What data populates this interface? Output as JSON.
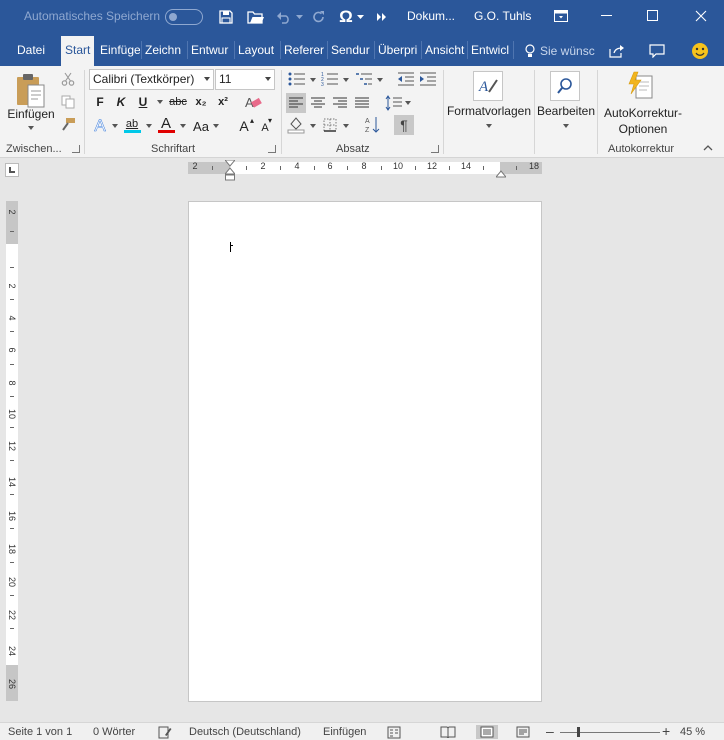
{
  "titlebar": {
    "autosave_label": "Automatisches Speichern",
    "doc_title": "Dokum...",
    "user_name": "G.O. Tuhls"
  },
  "tabs": {
    "items": [
      "Datei",
      "Start",
      "Einfüge",
      "Zeichn",
      "Entwur",
      "Layout",
      "Referer",
      "Sendur",
      "Überpri",
      "Ansicht",
      "Entwicl"
    ],
    "active": "Start",
    "tell_me": "Sie wünsc"
  },
  "ribbon": {
    "clipboard": {
      "paste_label": "Einfügen",
      "group_label": "Zwischen..."
    },
    "font": {
      "font_name": "Calibri (Textkörper)",
      "font_size": "11",
      "bold": "F",
      "italic": "K",
      "underline": "U",
      "strike": "abc",
      "subscript": "x₂",
      "superscript": "x²",
      "text_effects": "A",
      "highlight": "ab",
      "font_color": "A",
      "change_case": "Aa",
      "grow": "A",
      "shrink": "A",
      "group_label": "Schriftart"
    },
    "paragraph": {
      "show_marks": "¶",
      "group_label": "Absatz"
    },
    "styles": {
      "label": "Formatvorlagen"
    },
    "editing": {
      "label": "Bearbeiten"
    },
    "autocorrect": {
      "label_line1": "AutoKorrektur-",
      "label_line2": "Optionen",
      "group_label": "Autokorrektur"
    }
  },
  "ruler": {
    "h_labels": [
      "2",
      "2",
      "4",
      "6",
      "8",
      "10",
      "12",
      "14",
      "18"
    ],
    "v_labels": [
      "2",
      "2",
      "4",
      "6",
      "8",
      "10",
      "12",
      "14",
      "16",
      "18",
      "20",
      "22",
      "24",
      "26"
    ]
  },
  "statusbar": {
    "page": "Seite 1 von 1",
    "words": "0 Wörter",
    "language": "Deutsch (Deutschland)",
    "mode": "Einfügen",
    "zoom": "45 %"
  },
  "colors": {
    "accent": "#2b579a",
    "ribbon_bg": "#f3f3f3",
    "highlight_cyan": "#00c8e8",
    "font_red": "#e00000"
  }
}
